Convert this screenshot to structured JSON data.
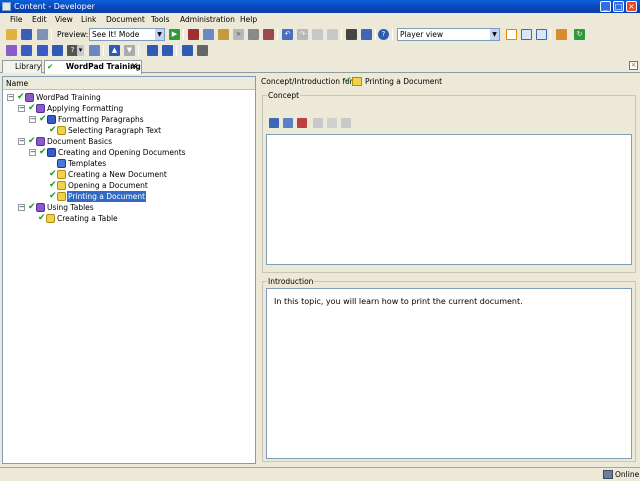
{
  "window": {
    "title": "Content - Developer"
  },
  "menu": [
    "File",
    "Edit",
    "View",
    "Link",
    "Document",
    "Tools",
    "Administration",
    "Help"
  ],
  "toolbar": {
    "preview_label": "Preview:",
    "mode_value": "See It! Mode",
    "view_value": "Player view"
  },
  "tabs": [
    {
      "label": "Library"
    },
    {
      "label": "WordPad Training"
    }
  ],
  "outline": {
    "column_header": "Name",
    "items": [
      {
        "label": "WordPad Training",
        "icon": "book-icon"
      },
      {
        "label": "Applying Formatting",
        "icon": "book-icon"
      },
      {
        "label": "Formatting Paragraphs",
        "icon": "concept-icon"
      },
      {
        "label": "Selecting Paragraph Text",
        "icon": "topic-icon"
      },
      {
        "label": "Document Basics",
        "icon": "book-icon"
      },
      {
        "label": "Creating and Opening Documents",
        "icon": "concept-icon"
      },
      {
        "label": "Templates",
        "icon": "web-page-icon"
      },
      {
        "label": "Creating a New Document",
        "icon": "topic-icon"
      },
      {
        "label": "Opening a Document",
        "icon": "topic-icon"
      },
      {
        "label": "Printing a Document",
        "icon": "topic-icon",
        "selected": true
      },
      {
        "label": "Using Tables",
        "icon": "book-icon"
      },
      {
        "label": "Creating a Table",
        "icon": "topic-icon"
      }
    ]
  },
  "detail": {
    "header_label": "Concept/Introduction for:",
    "doc_title": "Printing a Document",
    "concept_legend": "Concept",
    "intro_legend": "Introduction",
    "intro_text": "In this topic, you will learn how to print the current document."
  },
  "status": {
    "text": "Online"
  }
}
